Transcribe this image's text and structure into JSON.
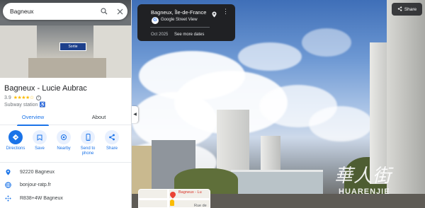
{
  "search": {
    "query": "Bagneux",
    "search_icon": "search-icon",
    "close_icon": "close-icon"
  },
  "place": {
    "title": "Bagneux - Lucie Aubrac",
    "rating": "3.9",
    "stars": "★★★★☆",
    "type": "Subway station",
    "accessible_icon": "wheelchair-icon"
  },
  "tabs": [
    {
      "label": "Overview",
      "active": true
    },
    {
      "label": "About",
      "active": false
    }
  ],
  "actions": [
    {
      "label": "Directions",
      "icon": "directions-icon"
    },
    {
      "label": "Save",
      "icon": "bookmark-icon"
    },
    {
      "label": "Nearby",
      "icon": "nearby-icon"
    },
    {
      "label": "Send to phone",
      "icon": "phone-icon"
    },
    {
      "label": "Share",
      "icon": "share-icon"
    }
  ],
  "info": [
    {
      "text": "92220 Bagneux",
      "icon": "location-pin-icon"
    },
    {
      "text": "bonjour-ratp.fr",
      "icon": "globe-icon"
    },
    {
      "text": "R838+4W Bagneux",
      "icon": "plus-code-icon"
    }
  ],
  "photo_sign": "Sortie",
  "streetview": {
    "place": "Bagneux, Île-de-France",
    "source": "Google Street View",
    "date": "Oct 2025",
    "see_more": "See more dates"
  },
  "share_label": "Share",
  "minimap": {
    "label1": "Bagneux - Lu",
    "label2": "Rue de"
  },
  "watermark": {
    "big": "華人街",
    "small": "HUARENJIE"
  },
  "colors": {
    "accent": "#1a73e8",
    "star": "#fbbc04",
    "card": "#202124"
  }
}
